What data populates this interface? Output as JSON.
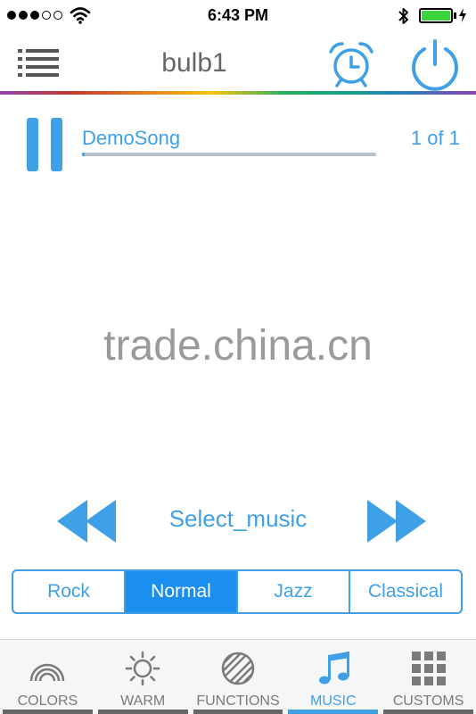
{
  "status_bar": {
    "time": "6:43 PM",
    "signal_bars": 3,
    "signal_max": 5,
    "battery_level": 1.0
  },
  "header": {
    "title": "bulb1"
  },
  "player": {
    "song_name": "DemoSong",
    "track_count": "1 of 1",
    "progress": 0.01
  },
  "watermark": "trade.china.cn",
  "controls": {
    "select_label": "Select_music"
  },
  "genres": {
    "options": [
      "Rock",
      "Normal",
      "Jazz",
      "Classical"
    ],
    "selected": "Normal"
  },
  "tabs": {
    "items": [
      "COLORS",
      "WARM",
      "FUNCTIONS",
      "MUSIC",
      "CUSTOMS"
    ],
    "selected": "MUSIC"
  },
  "colors": {
    "accent": "#3fa0e6",
    "active_segment": "#1a8ff0",
    "battery": "#3cd33c"
  },
  "icons": {
    "menu": "list-icon",
    "alarm": "alarm-clock-icon",
    "power": "power-icon",
    "pause": "pause-icon",
    "rewind": "rewind-icon",
    "forward": "fast-forward-icon",
    "tab_colors": "rainbow-icon",
    "tab_warm": "sun-icon",
    "tab_functions": "striped-circle-icon",
    "tab_music": "music-note-icon",
    "tab_customs": "grid-icon"
  }
}
